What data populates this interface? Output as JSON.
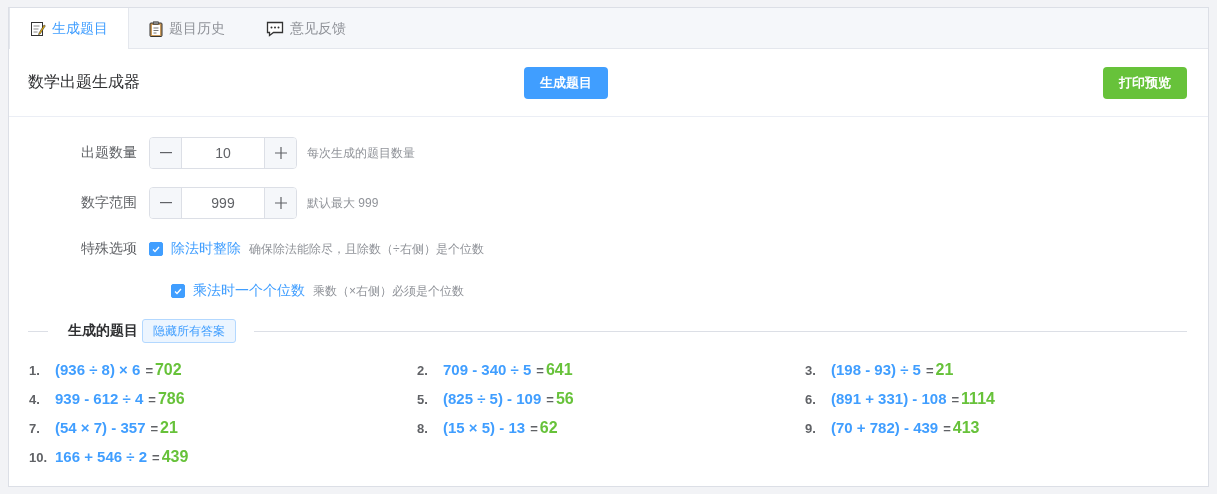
{
  "tabs": [
    {
      "label": "生成题目",
      "selected": true
    },
    {
      "label": "题目历史",
      "selected": false
    },
    {
      "label": "意见反馈",
      "selected": false
    }
  ],
  "header": {
    "title": "数学出题生成器",
    "generate_button": "生成题目",
    "print_button": "打印预览"
  },
  "settings": [
    {
      "label": "出题数量",
      "value": "10",
      "hint": "每次生成的题目数量"
    },
    {
      "label": "数字范围",
      "value": "999",
      "hint": "默认最大 999"
    }
  ],
  "options": {
    "label": "特殊选项",
    "items": [
      {
        "label": "除法时整除",
        "hint": "确保除法能除尽，且除数（÷右侧）是个位数",
        "checked": true
      },
      {
        "label": "乘法时一个个位数",
        "hint": "乘数（×右侧）必须是个位数",
        "checked": true
      }
    ]
  },
  "problems": {
    "title": "生成的题目",
    "toggle_button": "隐藏所有答案",
    "items": [
      {
        "number": "1.",
        "expression": "(936 ÷ 8) × 6",
        "equals": "=",
        "answer": "702"
      },
      {
        "number": "2.",
        "expression": "709 - 340 ÷ 5",
        "equals": "=",
        "answer": "641"
      },
      {
        "number": "3.",
        "expression": "(198 - 93) ÷ 5",
        "equals": "=",
        "answer": "21"
      },
      {
        "number": "4.",
        "expression": "939 - 612 ÷ 4",
        "equals": "=",
        "answer": "786"
      },
      {
        "number": "5.",
        "expression": "(825 ÷ 5) - 109",
        "equals": "=",
        "answer": "56"
      },
      {
        "number": "6.",
        "expression": "(891 + 331) - 108",
        "equals": "=",
        "answer": "1114"
      },
      {
        "number": "7.",
        "expression": "(54 × 7) - 357",
        "equals": "=",
        "answer": "21"
      },
      {
        "number": "8.",
        "expression": "(15 × 5) - 13",
        "equals": "=",
        "answer": "62"
      },
      {
        "number": "9.",
        "expression": "(70 + 782) - 439",
        "equals": "=",
        "answer": "413"
      },
      {
        "number": "10.",
        "expression": "166 + 546 ÷ 2",
        "equals": "=",
        "answer": "439"
      }
    ]
  }
}
